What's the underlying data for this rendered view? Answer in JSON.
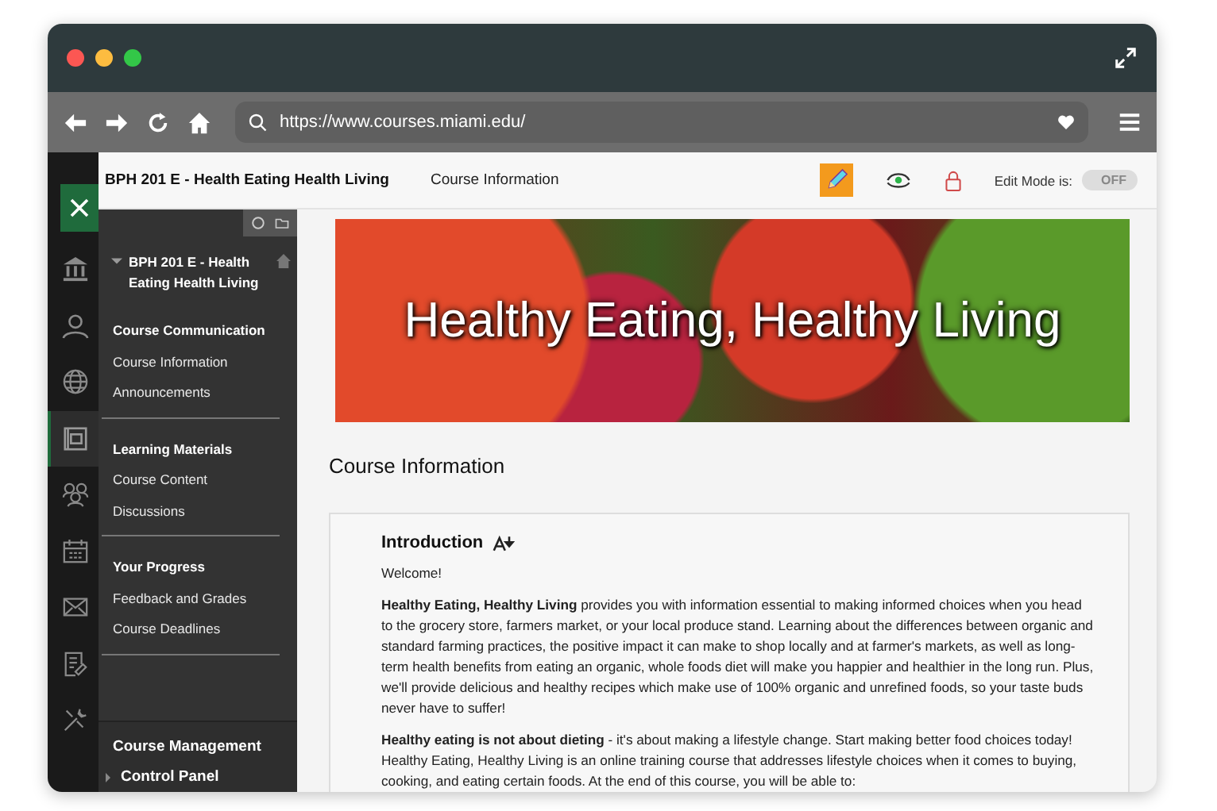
{
  "browser": {
    "url": "https://www.courses.miami.edu/"
  },
  "header": {
    "course_title": "BPH 201 E - Health Eating Health Living",
    "breadcrumb": "Course Information",
    "edit_mode_label": "Edit Mode is:",
    "edit_mode": {
      "on": false,
      "label": "OFF"
    }
  },
  "rail": [
    {
      "kind": "institution",
      "selected": false
    },
    {
      "kind": "person",
      "selected": false
    },
    {
      "kind": "globe",
      "selected": false
    },
    {
      "kind": "course",
      "selected": true
    },
    {
      "kind": "groups",
      "selected": false
    },
    {
      "kind": "calendar",
      "selected": false
    },
    {
      "kind": "mail",
      "selected": false
    },
    {
      "kind": "grades",
      "selected": false
    },
    {
      "kind": "tools",
      "selected": false
    }
  ],
  "course_menu": {
    "title": "BPH 201 E - Health Eating Health Living",
    "expanded": true,
    "sections": [
      {
        "heading": "Course Communication",
        "links": [
          "Course Information",
          "Announcements"
        ]
      },
      {
        "heading": "Learning Materials",
        "links": [
          "Course Content",
          "Discussions"
        ]
      },
      {
        "heading": "Your Progress",
        "links": [
          "Feedback and Grades",
          "Course Deadlines"
        ]
      }
    ],
    "management": {
      "heading": "Course Management",
      "control_panel": "Control Panel",
      "expanded": false
    }
  },
  "banner": {
    "title": "Healthy Eating, Healthy Living"
  },
  "page_title": "Course Information",
  "item": {
    "title": "Introduction",
    "paragraphs": [
      "Welcome!",
      "**Healthy Eating, Healthy Living** provides you with information essential to making informed choices when you head to the grocery store, farmers market, or your local produce stand. Learning about the differences between organic and standard farming practices, the positive impact it can make to shop locally and at farmer's markets, as well as long-term health benefits from eating an organic, whole foods diet will make you happier and healthier in the long run. Plus, we'll provide delicious and healthy recipes which make use of 100% organic and unrefined foods, so your taste buds never have to suffer!",
      "**Healthy eating is not about dieting** - it's about making a lifestyle change. Start making better food choices today! Healthy Eating, Healthy Living is an online training course that addresses lifestyle choices when it comes to buying, cooking, and eating certain foods. At the end of this course, you will be able to:"
    ]
  }
}
